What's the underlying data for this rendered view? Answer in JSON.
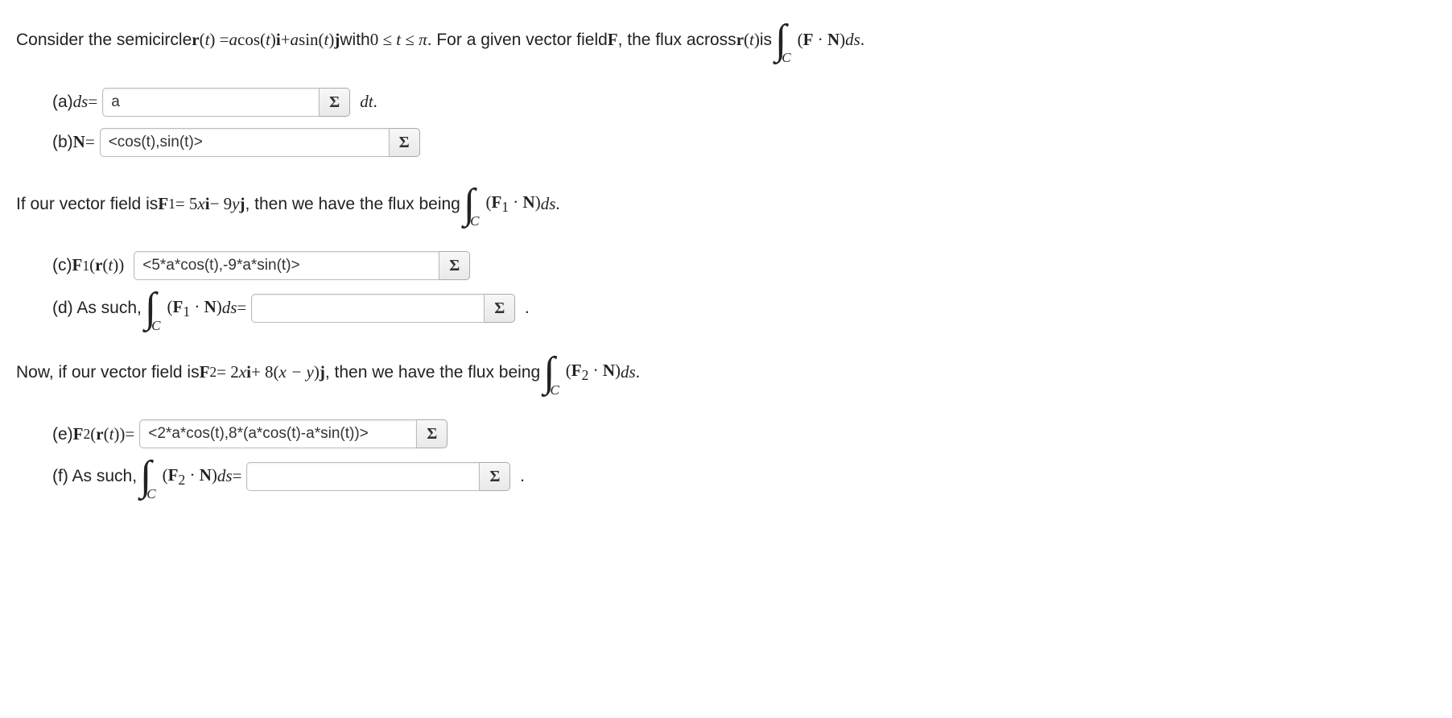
{
  "intro": {
    "prefix": "Consider the semicircle ",
    "r_of_t": "r",
    "t_arg": "(t) = ",
    "expr_a": "a",
    "cos": " cos(",
    "t": "t",
    "close": ")",
    "i": "i",
    "plus": " + ",
    "sin": " sin(",
    "j": "j",
    "with": " with ",
    "range": "0 ≤ t ≤ π",
    "for_given": ". For a given vector field ",
    "F": "F",
    "flux_text": ", the flux across ",
    "is": " is ",
    "FdotN": "(F · N)",
    "ds": " ds",
    "period": "."
  },
  "parts": {
    "a": {
      "label": "(a) ",
      "ds": "ds",
      "eq": " = ",
      "value": "a",
      "dt": "dt",
      "period": "."
    },
    "b": {
      "label": "(b) ",
      "N": "N",
      "eq": " = ",
      "value": "<cos(t),sin(t)>"
    },
    "mid1": {
      "prefix": "If our vector field is ",
      "F1": "F",
      "sub1": "1",
      "eq": " = 5",
      "x": "x",
      "i": "i",
      "minus": " − 9",
      "y": "y",
      "j": "j",
      "then": ", then we have the flux being ",
      "integrand": "(F",
      "dot": " · N)",
      "ds": "ds",
      "period": "."
    },
    "c": {
      "label": "(c) ",
      "F1": "F",
      "sub1": "1",
      "r_of_t": "(r(t))",
      "value": "<5*a*cos(t),-9*a*sin(t)>"
    },
    "d": {
      "label": "(d) As such, ",
      "integrand_F": "(F",
      "sub1": "1",
      "dotN": " · N)",
      "ds": " ds",
      "eq": " = ",
      "value": "",
      "period": "."
    },
    "mid2": {
      "prefix": "Now, if our vector field is ",
      "F2": "F",
      "sub2": "2",
      "eq": " = 2",
      "x": "x",
      "i": "i",
      "plus": " + 8(",
      "xmy": "x − y",
      "close": ")",
      "j": "j",
      "then": ", then we have the flux being ",
      "integrand": "(F",
      "dot": " · N)",
      "ds": "ds",
      "period": "."
    },
    "e": {
      "label": "(e) ",
      "F2": "F",
      "sub2": "2",
      "r_of_t": "(r(t))",
      "eq": " = ",
      "value": "<2*a*cos(t),8*(a*cos(t)-a*sin(t))>"
    },
    "f": {
      "label": "(f) As such, ",
      "integrand_F": "(F",
      "sub2": "2",
      "dotN": " · N)",
      "ds": " ds",
      "eq": " = ",
      "value": "",
      "period": "."
    }
  },
  "sigma": "Σ",
  "integral_sub": "C"
}
